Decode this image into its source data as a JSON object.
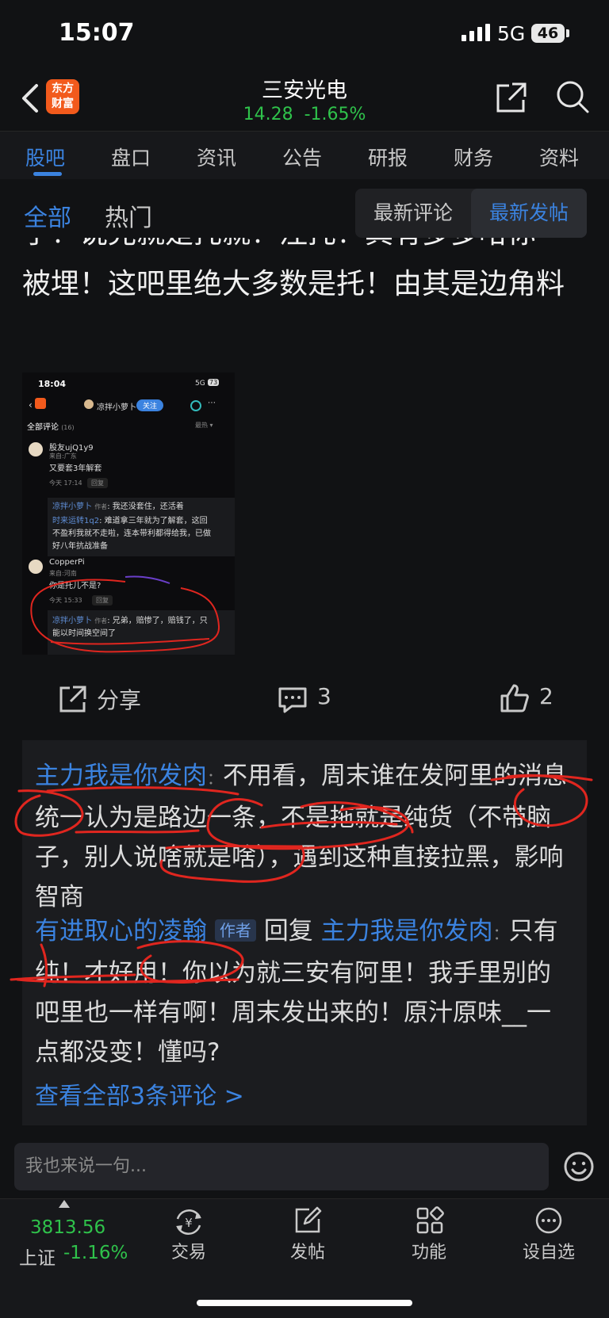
{
  "status": {
    "time": "15:07",
    "network": "5G",
    "battery": "46"
  },
  "header": {
    "logo_text": "东方\n财富",
    "stock_name": "三安光电",
    "price": "14.28",
    "change": "-1.65%"
  },
  "tabs": [
    "股吧",
    "盘口",
    "资讯",
    "公告",
    "研报",
    "财务",
    "资料"
  ],
  "subnav": {
    "all": "全部",
    "hot": "热门",
    "sort_a": "最新评论",
    "sort_b": "最新发帖"
  },
  "post": {
    "cut_line": "子！说児就是托就！注托！真有多多哈你",
    "body": "被埋！这吧里绝大多数是托！由其是边角料"
  },
  "embedded": {
    "time": "18:04",
    "net": "5G",
    "batt": "73",
    "user": "凉拌小萝卜",
    "follow": "关注",
    "all_comments": "全部评论",
    "count": "(16)",
    "sort": "最热 ▾",
    "c1_name": "股友ujQ1y9",
    "c1_from": "来自:广东",
    "c1_text": "又要套3年解套",
    "c1_time": "今天 17:14",
    "reply": "回复",
    "r1_name": "凉拌小萝卜",
    "r1_badge": "作者",
    "r1_text": "我还没套住，还活着",
    "r2_name": "时来运转1q2",
    "r2_text": "难道拿三年就为了解套，这回",
    "r2_text2": "不盈利我就不走啦，连本带利都得给我，已做",
    "r2_text3": "好八年抗战准备",
    "c2_name": "CopperPi",
    "c2_from": "来自:河南",
    "c2_text": "你是托儿不是?",
    "c2_time": "今天 15:33",
    "r3_name": "凉拌小萝卜",
    "r3_text": "兄弟，赔惨了，赔钱了，只",
    "r3_text2": "能以时间换空间了"
  },
  "actions": {
    "share": "分享",
    "comments": "3",
    "likes": "2"
  },
  "comments": [
    {
      "name": "主力我是你发肉",
      "text": "不用看，周末谁在发阿里的消息统一认为是路边一条，不是拖就是纯货（不带脑子，别人说啥就是啥），遇到这种直接拉黑，影响智商"
    },
    {
      "name": "有进取心的凌翰",
      "badge": "作者",
      "reply_word": "回复",
      "reply_to": "主力我是你发肉",
      "text": "只有纯！才好用！你以为就三安有阿里！我手里别的吧里也一样有啊！周末发出来的！原汁原味__一点都没变！懂吗?"
    }
  ],
  "view_all": "查看全部3条评论 >",
  "input_placeholder": "我也来说一句...",
  "bottom": {
    "index_value": "3813.56",
    "index_name": "上证",
    "index_change": "-1.16%",
    "trade": "交易",
    "post": "发帖",
    "functions": "功能",
    "watchlist": "设自选"
  },
  "colors": {
    "accent": "#3b83e0",
    "down_green": "#2fc24b",
    "brand": "#f25a1c",
    "annotation_red": "#e0261f"
  }
}
